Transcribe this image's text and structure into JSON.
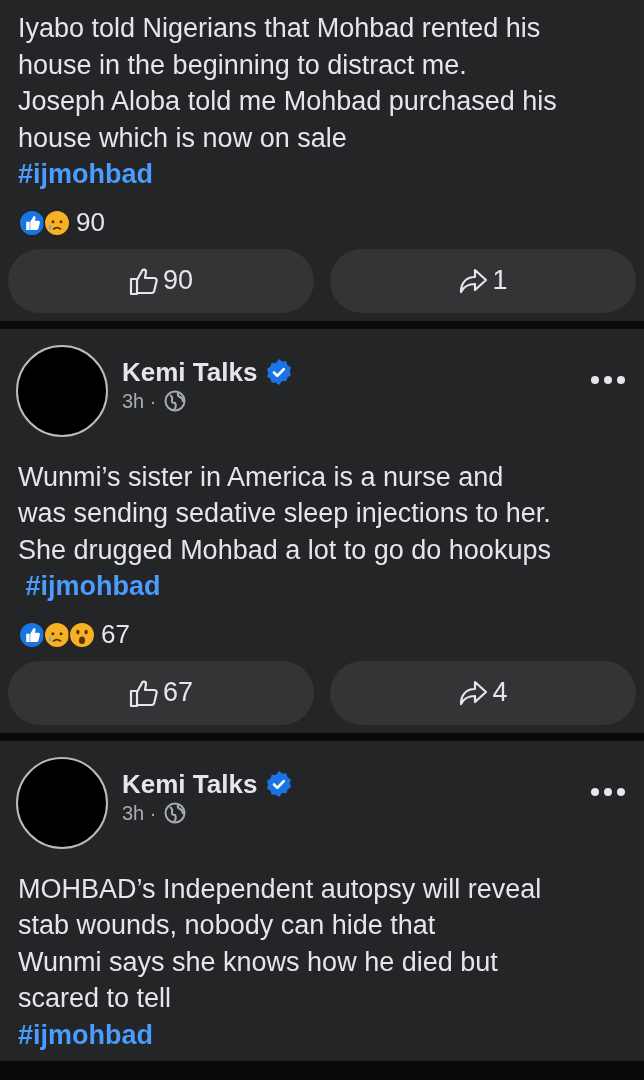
{
  "posts": [
    {
      "text": "Iyabo told Nigerians that Mohbad rented his\nhouse in the beginning to distract me.\nJoseph Aloba told me Mohbad purchased his\nhouse which is now on sale",
      "hashtag": "#ijmohbad",
      "reactions": [
        {
          "kind": "like"
        },
        {
          "kind": "sad"
        }
      ],
      "reaction_count": "90",
      "like_count": "90",
      "share_count": "1"
    },
    {
      "author": {
        "name": "Kemi Talks",
        "verified": true,
        "time": "3h ·"
      },
      "text": "Wunmi’s sister in America is a nurse and\nwas sending sedative sleep injections to her.\nShe drugged Mohbad a lot to go do hookups",
      "hashtag": " #ijmohbad",
      "reactions": [
        {
          "kind": "like"
        },
        {
          "kind": "sad"
        },
        {
          "kind": "wow"
        }
      ],
      "reaction_count": "67",
      "like_count": "67",
      "share_count": "4"
    },
    {
      "author": {
        "name": "Kemi Talks",
        "verified": true,
        "time": "3h ·"
      },
      "text": "MOHBAD’s Independent autopsy will reveal\nstab wounds, nobody can hide that\nWunmi says she knows how he died but\nscared to tell",
      "hashtag": "#ijmohbad"
    }
  ]
}
